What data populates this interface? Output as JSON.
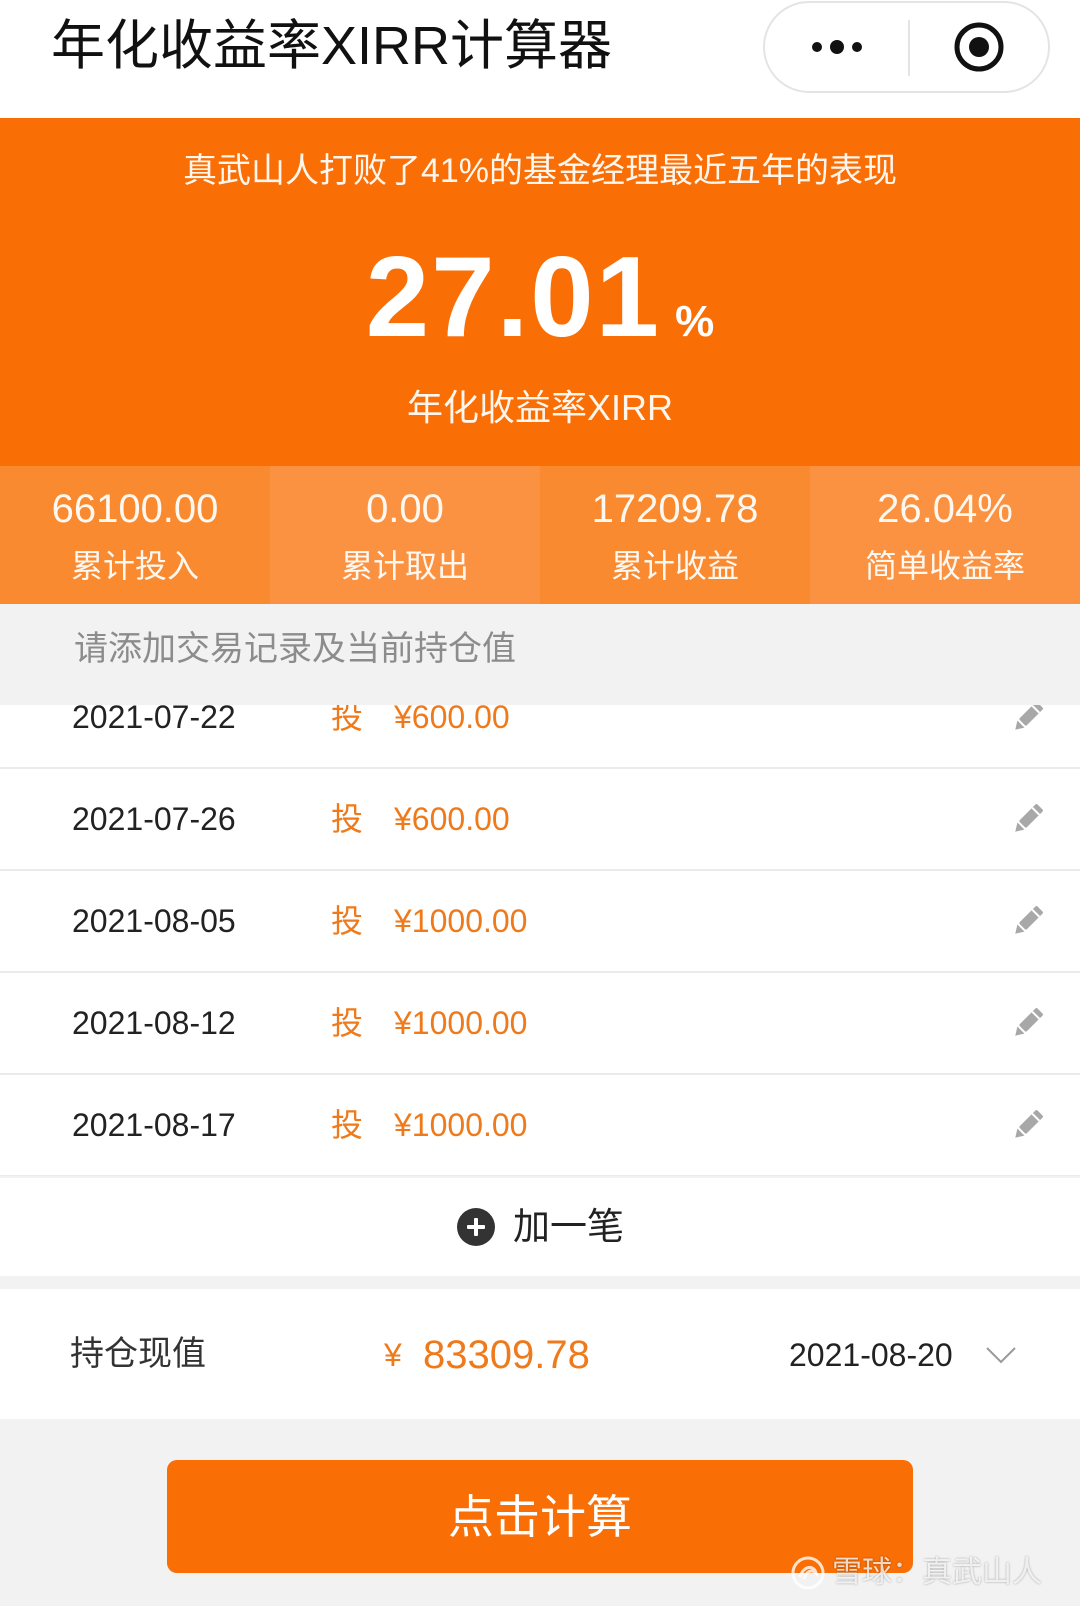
{
  "header": {
    "title": "年化收益率XIRR计算器",
    "more_icon": "more-dots-icon",
    "close_icon": "target-icon"
  },
  "summary": {
    "headline": "真武山人打败了41%的基金经理最近五年的表现",
    "xirr_value": "27.01",
    "xirr_unit": "%",
    "xirr_label": "年化收益率XIRR"
  },
  "stats": [
    {
      "value": "66100.00",
      "label": "累计投入"
    },
    {
      "value": "0.00",
      "label": "累计取出"
    },
    {
      "value": "17209.78",
      "label": "累计收益"
    },
    {
      "value": "26.04%",
      "label": "简单收益率"
    }
  ],
  "records": {
    "hint": "请添加交易记录及当前持仓值",
    "items": [
      {
        "date": "2021-07-22",
        "type": "投",
        "amount": "¥600.00"
      },
      {
        "date": "2021-07-26",
        "type": "投",
        "amount": "¥600.00"
      },
      {
        "date": "2021-08-05",
        "type": "投",
        "amount": "¥1000.00"
      },
      {
        "date": "2021-08-12",
        "type": "投",
        "amount": "¥1000.00"
      },
      {
        "date": "2021-08-17",
        "type": "投",
        "amount": "¥1000.00"
      }
    ],
    "edit_icon": "pencil-icon",
    "add_icon": "plus-circle-icon",
    "add_label": "加一笔"
  },
  "holding": {
    "label": "持仓现值",
    "currency": "¥",
    "value": "83309.78",
    "date": "2021-08-20",
    "date_icon": "chevron-down-icon"
  },
  "calculate_button": {
    "label": "点击计算"
  },
  "watermark": {
    "text": "雪球：真武山人",
    "logo": "xueqiu-logo-icon"
  },
  "colors": {
    "accent": "#FA6E06",
    "stat_dark": "#F98A30",
    "stat_light": "#FA9241",
    "amount": "#EE7A1B",
    "page_bg": "#F2F2F2"
  }
}
